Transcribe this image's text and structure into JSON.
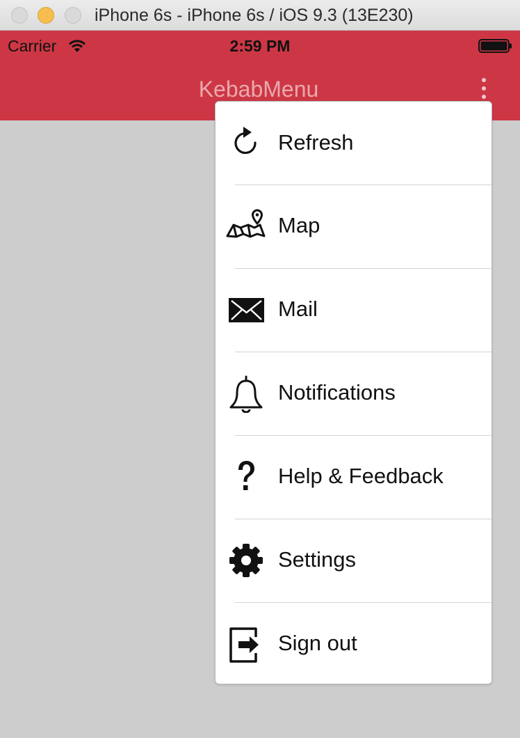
{
  "window": {
    "title": "iPhone 6s - iPhone 6s / iOS 9.3 (13E230)"
  },
  "status_bar": {
    "carrier": "Carrier",
    "time": "2:59 PM",
    "wifi_icon": "wifi-icon",
    "battery_icon": "battery-full-icon"
  },
  "nav_bar": {
    "title": "KebabMenu",
    "menu_icon": "kebab-menu-icon",
    "background_color": "#cd3745"
  },
  "menu": {
    "items": [
      {
        "label": "Refresh",
        "icon": "refresh-icon"
      },
      {
        "label": "Map",
        "icon": "map-icon"
      },
      {
        "label": "Mail",
        "icon": "mail-icon"
      },
      {
        "label": "Notifications",
        "icon": "bell-icon"
      },
      {
        "label": "Help & Feedback",
        "icon": "help-icon"
      },
      {
        "label": "Settings",
        "icon": "gear-icon"
      },
      {
        "label": "Sign out",
        "icon": "sign-out-icon"
      }
    ]
  }
}
